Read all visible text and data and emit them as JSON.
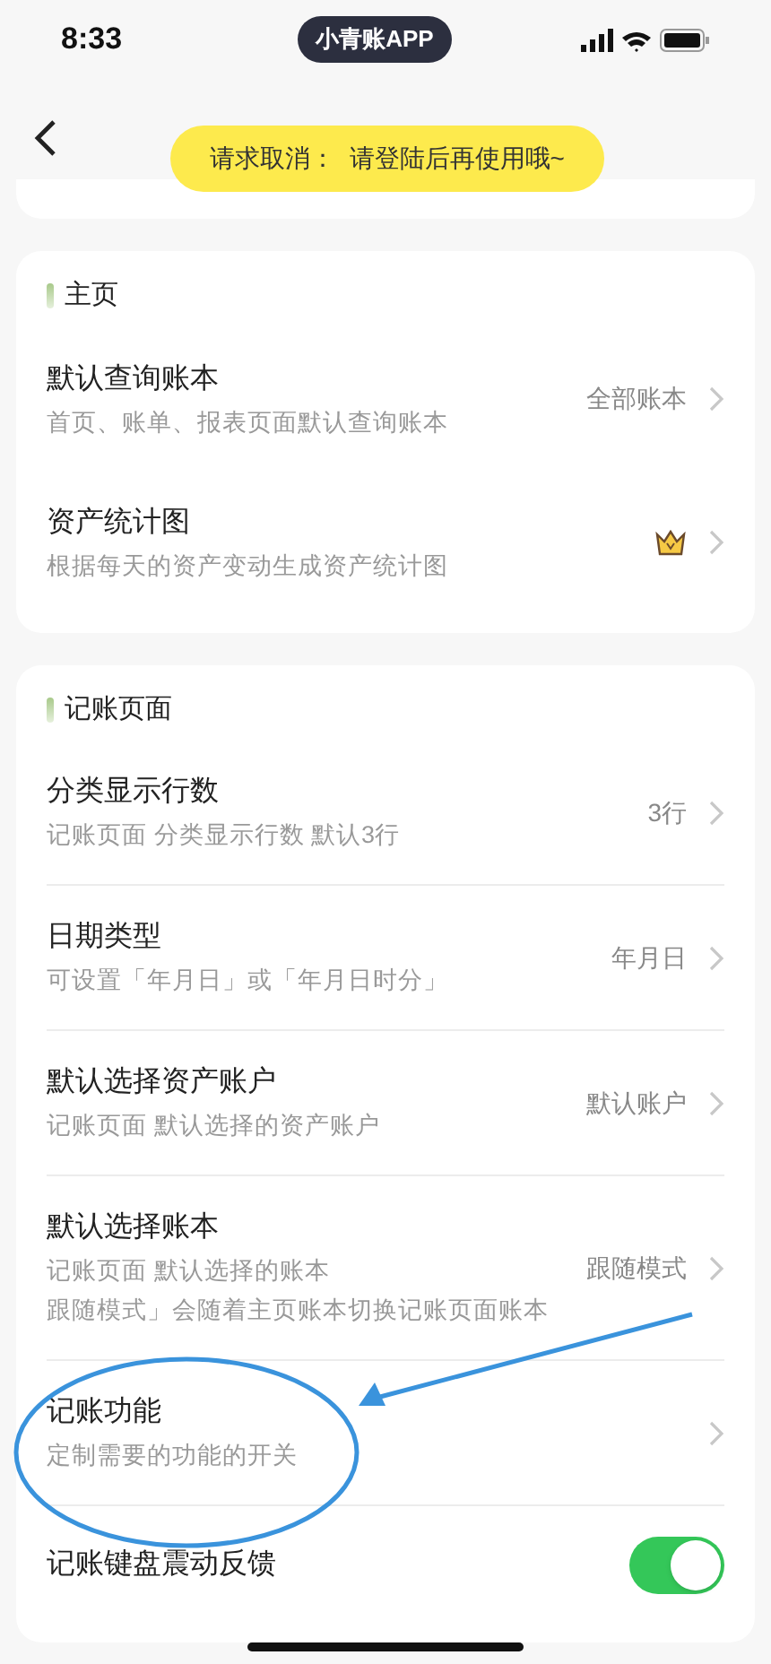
{
  "status_bar": {
    "time": "8:33",
    "app_pill": "小青账APP"
  },
  "toast": {
    "text": "请求取消：  请登陆后再使用哦~"
  },
  "sections": [
    {
      "title": "主页",
      "rows": [
        {
          "kind": "nav",
          "title": "默认查询账本",
          "subtitle": "首页、账单、报表页面默认查询账本",
          "value": "全部账本"
        },
        {
          "kind": "premium",
          "title": "资产统计图",
          "subtitle": "根据每天的资产变动生成资产统计图"
        }
      ]
    },
    {
      "title": "记账页面",
      "rows": [
        {
          "kind": "nav",
          "title": "分类显示行数",
          "subtitle": "记账页面 分类显示行数 默认3行",
          "value": "3行"
        },
        {
          "kind": "nav",
          "title": "日期类型",
          "subtitle": "可设置「年月日」或「年月日时分」",
          "value": "年月日"
        },
        {
          "kind": "nav",
          "title": "默认选择资产账户",
          "subtitle": "记账页面 默认选择的资产账户",
          "value": "默认账户"
        },
        {
          "kind": "nav",
          "title": "默认选择账本",
          "subtitle_lines": [
            "记账页面 默认选择的账本",
            "跟随模式」会随着主页账本切换记账页面账本"
          ],
          "value": "跟随模式"
        },
        {
          "kind": "nav",
          "title": "记账功能",
          "subtitle": "定制需要的功能的开关",
          "highlighted": true
        },
        {
          "kind": "toggle",
          "title": "记账键盘震动反馈",
          "on": true
        }
      ]
    }
  ]
}
